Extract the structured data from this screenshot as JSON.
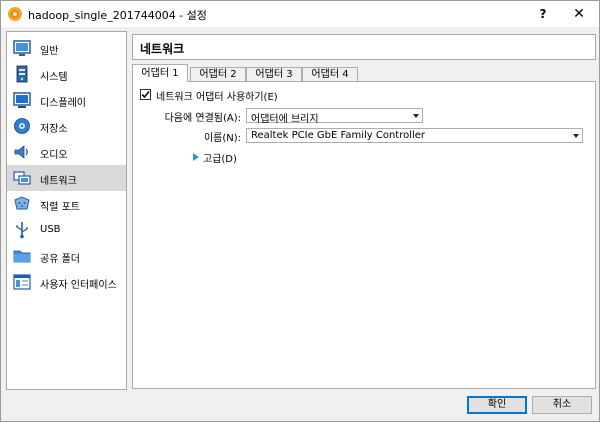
{
  "window": {
    "title": "hadoop_single_201744004 - 설정",
    "help_label": "?",
    "close_label": "✕"
  },
  "sidebar": {
    "items": [
      {
        "label": "일반",
        "icon": "general-icon"
      },
      {
        "label": "시스템",
        "icon": "system-icon"
      },
      {
        "label": "디스플레이",
        "icon": "display-icon"
      },
      {
        "label": "저장소",
        "icon": "storage-icon"
      },
      {
        "label": "오디오",
        "icon": "audio-icon"
      },
      {
        "label": "네트워크",
        "icon": "network-icon",
        "selected": true
      },
      {
        "label": "직렬 포트",
        "icon": "serial-port-icon"
      },
      {
        "label": "USB",
        "icon": "usb-icon"
      },
      {
        "label": "공유 폴더",
        "icon": "shared-folder-icon"
      },
      {
        "label": "사용자 인터페이스",
        "icon": "user-interface-icon"
      }
    ]
  },
  "main": {
    "title": "네트워크",
    "tabs": [
      {
        "label": "어댑터 1",
        "active": true
      },
      {
        "label": "어댑터 2"
      },
      {
        "label": "어댑터 3"
      },
      {
        "label": "어댑터 4"
      }
    ],
    "enable_adapter": {
      "label": "네트워크 어댑터 사용하기(E)",
      "checked": true
    },
    "attached_to": {
      "label": "다음에 연결됨(A):",
      "value": "어댑터에 브리지"
    },
    "name": {
      "label": "이름(N):",
      "value": "Realtek PCIe GbE Family Controller"
    },
    "advanced": {
      "label": "고급(D)"
    }
  },
  "buttons": {
    "ok": "확인",
    "cancel": "취소"
  },
  "colors": {
    "selected_item": "#d9d9d9",
    "advanced_arrow": "#3a8fd8",
    "default_button_border": "#0078d7"
  }
}
